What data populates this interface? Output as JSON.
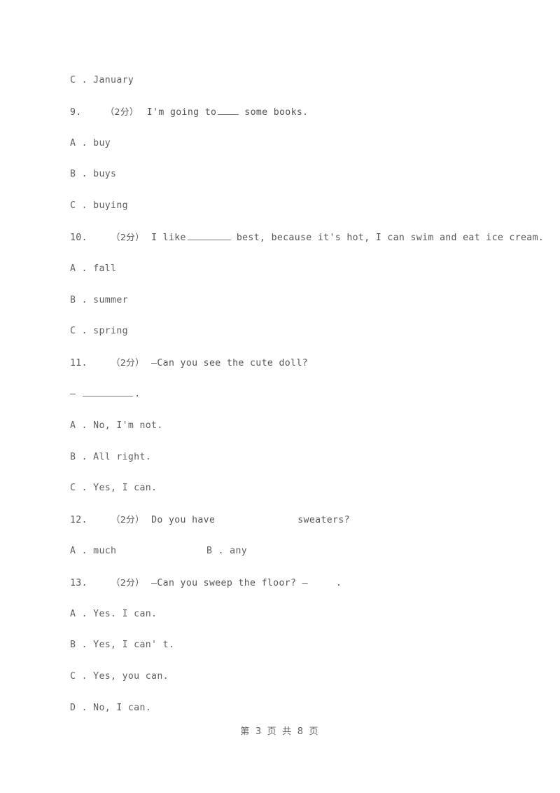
{
  "document": {
    "type": "exam-paper",
    "page_label": "第 3 页 共 8 页",
    "page_number": "3",
    "total_pages": "8"
  },
  "lines": {
    "carryover_option_c": "C . January",
    "q9": {
      "number": "9.",
      "score": "（2分）",
      "text_before": "I'm going to",
      "text_after": "some books.",
      "options": {
        "a": "A . buy",
        "b": "B . buys",
        "c": "C . buying"
      }
    },
    "q10": {
      "number": "10.",
      "score": "（2分）",
      "text_before": "I like",
      "text_after": "best, because it's hot, I can swim and eat ice cream.",
      "options": {
        "a": "A . fall",
        "b": "B . summer",
        "c": "C . spring"
      }
    },
    "q11": {
      "number": "11.",
      "score": "（2分）",
      "text": "—Can you see the cute doll?",
      "answer_dash": "—",
      "answer_period": ".",
      "options": {
        "a": "A . No, I'm not.",
        "b": "B . All right.",
        "c": "C . Yes, I can."
      }
    },
    "q12": {
      "number": "12.",
      "score": "（2分）",
      "text_before": "Do you have",
      "text_after": "sweaters?",
      "options": {
        "a": "A . much",
        "b": "B . any"
      }
    },
    "q13": {
      "number": "13.",
      "score": "（2分）",
      "text_before": "—Can you sweep the floor? —",
      "text_after": ".",
      "options": {
        "a": "A . Yes. I can.",
        "b": "B . Yes, I can' t.",
        "c": "C . Yes, you can.",
        "d": "D . No, I can."
      }
    }
  },
  "colors": {
    "page_background": "#ffffff",
    "body_text": "#5a5a5a",
    "blank_rule": "#7a7a7a"
  }
}
